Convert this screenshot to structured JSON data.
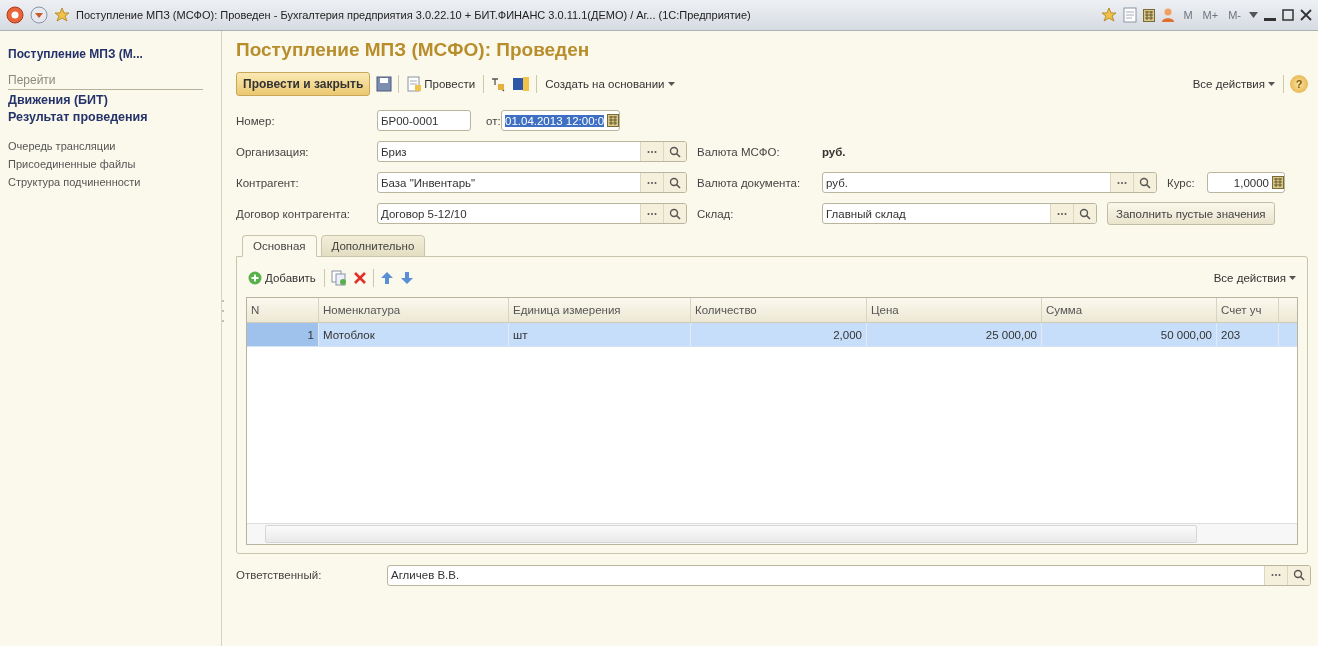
{
  "window": {
    "title": "Поступление МПЗ (МСФО): Проведен - Бухгалтерия предприятия 3.0.22.10 + БИТ.ФИНАНС 3.0.11.1(ДЕМО) / Аг...  (1С:Предприятие)",
    "memory_buttons": [
      {
        "label": "M",
        "disabled": true
      },
      {
        "label": "M+",
        "disabled": true
      },
      {
        "label": "M-",
        "disabled": true
      }
    ]
  },
  "sidebar": {
    "title": "Поступление МПЗ (М...",
    "section": "Перейти",
    "items": [
      {
        "label": "Движения (БИТ)",
        "kind": "primary"
      },
      {
        "label": "Результат проведения",
        "kind": "primary"
      },
      {
        "label": "Очередь трансляции",
        "kind": "secondary"
      },
      {
        "label": "Присоединенные файлы",
        "kind": "secondary"
      },
      {
        "label": "Структура подчиненности",
        "kind": "secondary"
      }
    ]
  },
  "form": {
    "title": "Поступление МПЗ (МСФО): Проведен",
    "toolbar": {
      "primary_button": "Провести и закрыть",
      "post_button": "Провести",
      "create_menu": "Создать на основании",
      "all_actions": "Все действия",
      "help": "?"
    },
    "number": {
      "label": "Номер:",
      "value": "БР00-0001"
    },
    "date": {
      "label": "от:",
      "value": "01.04.2013 12:00:0",
      "selected": true
    },
    "organization": {
      "label": "Организация:",
      "value": "Бриз"
    },
    "ifrs_currency": {
      "label": "Валюта МСФО:",
      "value": "руб."
    },
    "counterparty": {
      "label": "Контрагент:",
      "value": "База \"Инвентарь\""
    },
    "document_currency": {
      "label": "Валюта документа:",
      "value": "руб."
    },
    "rate": {
      "label": "Курс:",
      "value": "1,0000"
    },
    "contract": {
      "label": "Договор контрагента:",
      "value": "Договор 5-12/10"
    },
    "warehouse": {
      "label": "Склад:",
      "value": "Главный склад"
    },
    "fill_button": "Заполнить пустые значения",
    "tabs": [
      {
        "label": "Основная",
        "selected": true
      },
      {
        "label": "Дополнительно",
        "selected": false
      }
    ],
    "table_toolbar": {
      "add_button": "Добавить",
      "all_actions": "Все действия"
    },
    "table": {
      "columns": [
        "N",
        "Номенклатура",
        "Единица измерения",
        "Количество",
        "Цена",
        "Сумма",
        "Счет уч"
      ],
      "rows": [
        {
          "cells": [
            "1",
            "Мотоблок",
            "шт",
            "2,000",
            "25 000,00",
            "50 000,00",
            "203"
          ],
          "selected": true
        }
      ]
    },
    "responsible": {
      "label": "Ответственный:",
      "value": "Агличев В.В."
    }
  }
}
